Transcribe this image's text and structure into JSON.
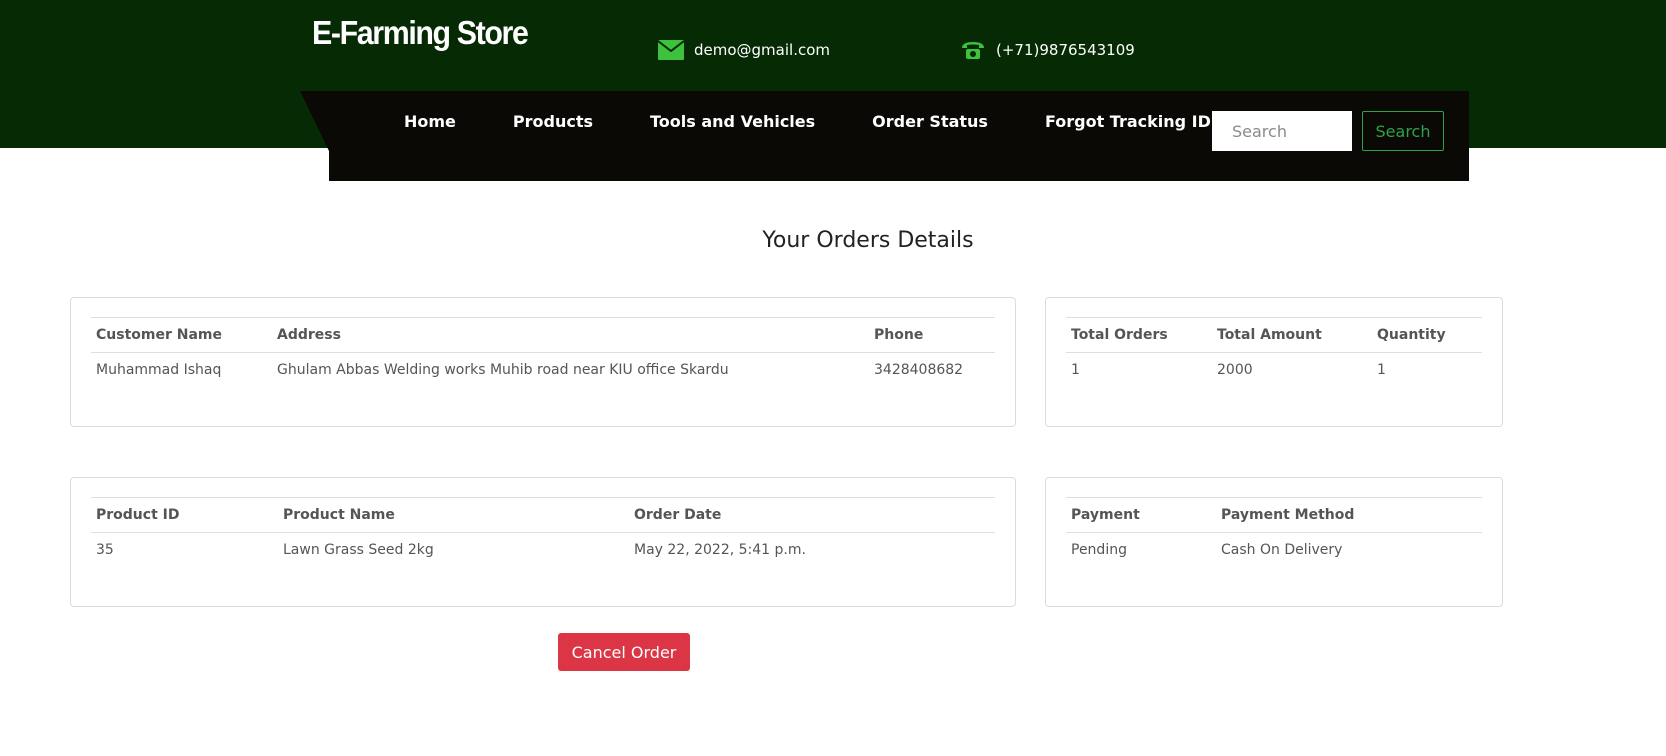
{
  "header": {
    "brand": "E-Farming Store",
    "email": "demo@gmail.com",
    "phone": "(+71)9876543109",
    "email_icon": "envelope-icon",
    "phone_icon": "telephone-icon"
  },
  "nav": {
    "items": [
      "Home",
      "Products",
      "Tools and Vehicles",
      "Order Status",
      "Forgot Tracking ID"
    ],
    "search_placeholder": "Search",
    "search_button": "Search"
  },
  "page": {
    "title": "Your Orders Details"
  },
  "customer_table": {
    "headers": [
      "Customer Name",
      "Address",
      "Phone"
    ],
    "row": [
      "Muhammad Ishaq",
      "Ghulam Abbas Welding works Muhib road near KIU office Skardu",
      "3428408682"
    ]
  },
  "summary_table": {
    "headers": [
      "Total Orders",
      "Total Amount",
      "Quantity"
    ],
    "row": [
      "1",
      "2000",
      "1"
    ]
  },
  "product_table": {
    "headers": [
      "Product ID",
      "Product Name",
      "Order Date"
    ],
    "row": [
      "35",
      "Lawn Grass Seed 2kg",
      "May 22, 2022, 5:41 p.m."
    ]
  },
  "payment_table": {
    "headers": [
      "Payment",
      "Payment Method"
    ],
    "row": [
      "Pending",
      "Cash On Delivery"
    ]
  },
  "actions": {
    "cancel_label": "Cancel Order"
  },
  "colors": {
    "topbar": "#052a04",
    "navbar": "#0b0905",
    "accent_green": "#2ca34a",
    "icon_green": "#3ec13c",
    "danger": "#dc3545"
  }
}
